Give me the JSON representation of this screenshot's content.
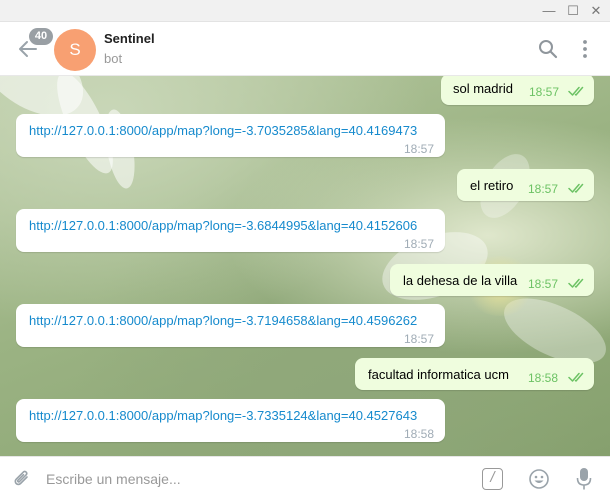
{
  "window": {
    "minimize_glyph": "—",
    "maximize_glyph": "☐",
    "close_glyph": "✕"
  },
  "header": {
    "unread_count": "40",
    "avatar_letter": "S",
    "avatar_color": "#f8a072",
    "chat_name": "Sentinel",
    "chat_status": "bot",
    "back_icon": "arrow-left-icon",
    "search_icon": "search-icon",
    "more_icon": "more-vertical-icon"
  },
  "colors": {
    "accent": "#168acd",
    "outgoing_bubble": "#effdde",
    "read_check": "#6cc264"
  },
  "messages": [
    {
      "direction": "out",
      "text": "sol madrid",
      "time": "18:57",
      "read": true
    },
    {
      "direction": "in",
      "text": "http://127.0.0.1:8000/app/map?long=-3.7035285&lang=40.4169473",
      "time": "18:57"
    },
    {
      "direction": "out",
      "text": "el retiro",
      "time": "18:57",
      "read": true
    },
    {
      "direction": "in",
      "text": "http://127.0.0.1:8000/app/map?long=-3.6844995&lang=40.4152606",
      "time": "18:57"
    },
    {
      "direction": "out",
      "text": "la dehesa de la villa",
      "time": "18:57",
      "read": true
    },
    {
      "direction": "in",
      "text": "http://127.0.0.1:8000/app/map?long=-3.7194658&lang=40.4596262",
      "time": "18:57"
    },
    {
      "direction": "out",
      "text": "facultad informatica ucm",
      "time": "18:58",
      "read": true
    },
    {
      "direction": "in",
      "text": "http://127.0.0.1:8000/app/map?long=-3.7335124&lang=40.4527643",
      "time": "18:58"
    }
  ],
  "composer": {
    "placeholder": "Escribe un mensaje...",
    "value": "",
    "command_glyph": "/",
    "attach_icon": "paperclip-icon",
    "emoji_icon": "emoji-icon",
    "mic_icon": "microphone-icon"
  }
}
